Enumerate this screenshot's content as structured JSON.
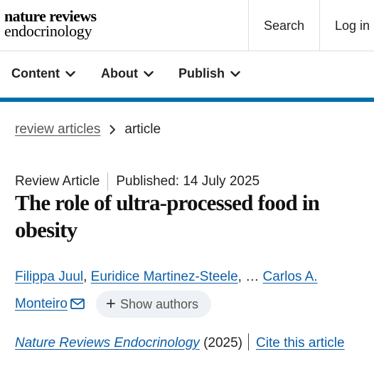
{
  "header": {
    "logo_line1": "nature reviews",
    "logo_line2": "endocrinology",
    "search_label": "Search",
    "login_label": "Log in"
  },
  "nav": {
    "items": [
      {
        "label": "Content",
        "icon": "chevron-down-icon"
      },
      {
        "label": "About",
        "icon": "chevron-down-icon"
      },
      {
        "label": "Publish",
        "icon": "chevron-down-icon"
      }
    ],
    "accent_color": "#0070a8"
  },
  "breadcrumb": {
    "link": "review articles",
    "current": "article"
  },
  "article": {
    "type": "Review Article",
    "published": "Published: 14 July 2025",
    "title": "The role of ultra-processed food in obesity",
    "authors": [
      "Filippa Juul",
      "Euridice Martinez-Steele",
      "Carlos A. Monteiro"
    ],
    "ellipsis": "…",
    "show_authors_label": "Show authors",
    "journal": "Nature Reviews Endocrinology",
    "year": "(2025)",
    "cite_label": "Cite this article"
  },
  "colors": {
    "link": "#0c5fa8",
    "text": "#222222"
  }
}
